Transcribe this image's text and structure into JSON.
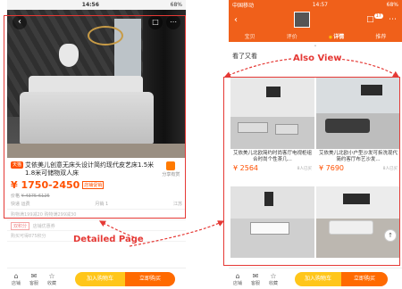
{
  "left_phone": {
    "status": {
      "carrier": "",
      "time": "14:56",
      "battery": "68%"
    },
    "product": {
      "tag": "天猫",
      "title": "艾依美儿创意无床头设计简约现代皮艺床1.5米 1.8米可储物双人床",
      "share_label": "分享有赏",
      "price": "¥ 1750-2450",
      "price_badge": "店铺促销",
      "orig_price_label": "价格",
      "orig_price": "¥ 4375-6125",
      "meta_left": "快递 运费",
      "meta_mid": "月销 1",
      "meta_right": "江苏",
      "promo_row": "购物满199减20 购物满299减30",
      "promo_pill": "双积分",
      "coupon_row": "店铺优惠券",
      "feature_row": "购买可得875积分"
    },
    "bottom": {
      "tab_store": "店铺",
      "tab_service": "客服",
      "tab_fav": "收藏",
      "add_cart": "加入购物车",
      "buy_now": "立即购买"
    }
  },
  "right_phone": {
    "status": {
      "carrier": "中国移动",
      "time": "14:57",
      "battery": "68%"
    },
    "header": {
      "cart_count": "17"
    },
    "tabs": [
      "宝贝",
      "评价",
      "详情",
      "推荐"
    ],
    "active_tab": "详情",
    "section_title": "看了又看",
    "cards": [
      {
        "title": "艾依美儿北欧简约时尚客厅电视柜组合时尚个性茶几...",
        "price": "¥ 2564",
        "sold": "8人已买"
      },
      {
        "title": "艾依美儿北欧小户型沙发可拆洗现代简约客厅布艺沙发...",
        "price": "¥ 7690",
        "sold": "8人已买"
      },
      {
        "title": "",
        "price": "",
        "sold": ""
      },
      {
        "title": "",
        "price": "",
        "sold": ""
      }
    ],
    "bottom": {
      "tab_store": "店铺",
      "tab_service": "客服",
      "tab_fav": "收藏",
      "add_cart": "加入购物车",
      "buy_now": "立即购买"
    }
  },
  "annotations": {
    "detail_page": "Detailed Page",
    "also_view": "Also View",
    "color": "#e53935"
  }
}
